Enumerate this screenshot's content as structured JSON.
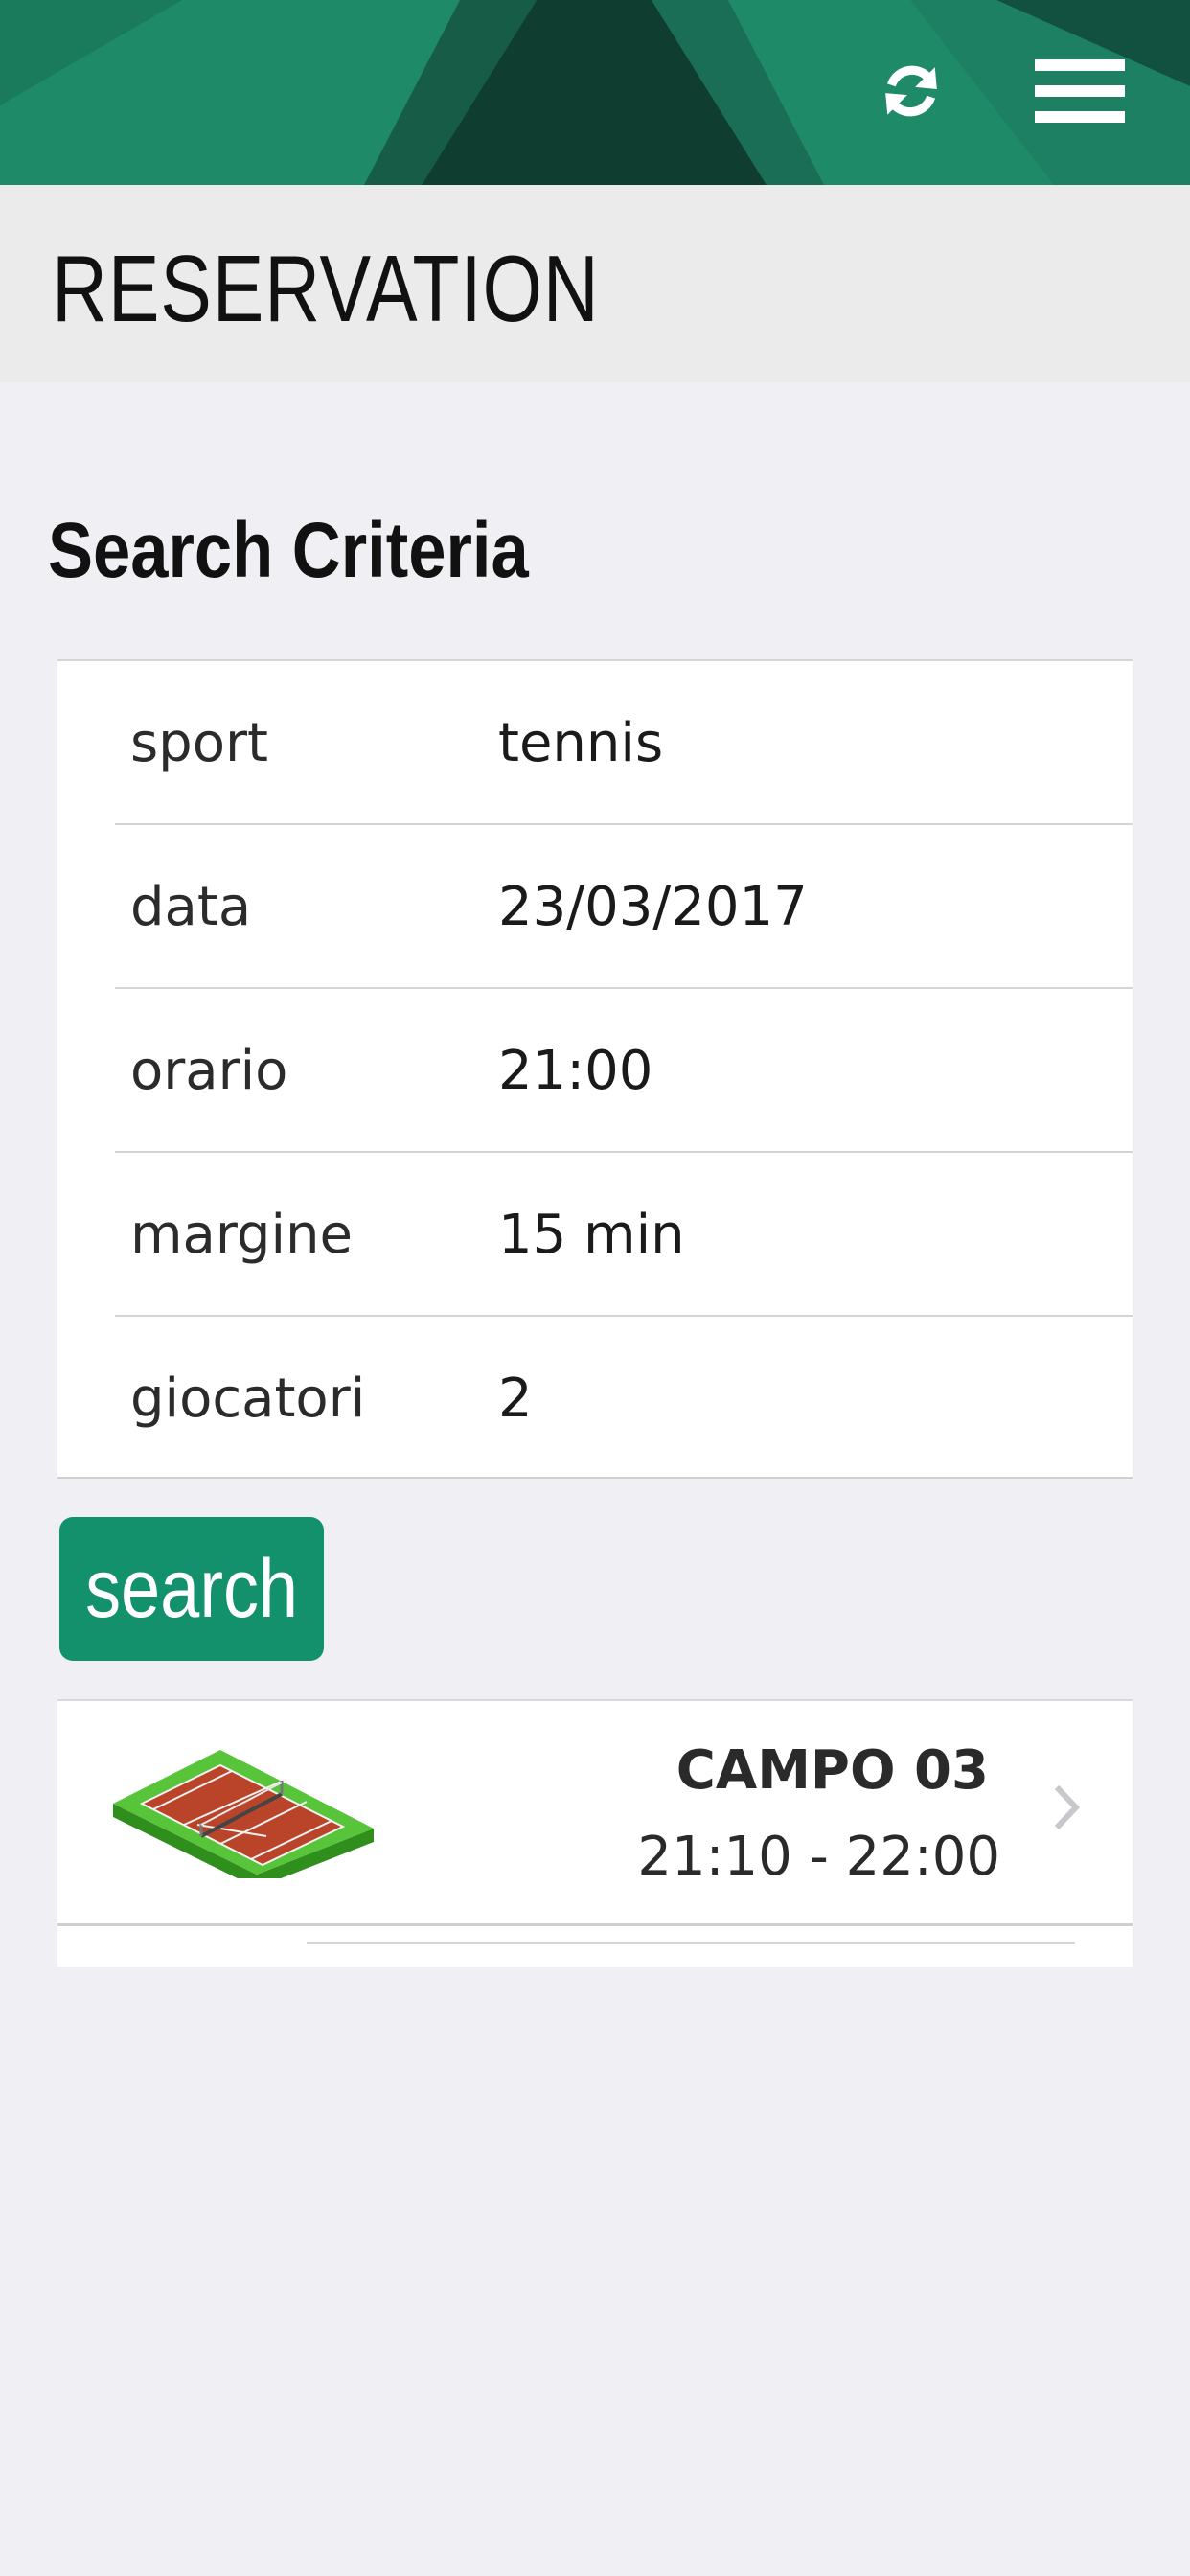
{
  "header": {
    "refresh_icon": "refresh-icon",
    "menu_icon": "hamburger-menu-icon",
    "brand_color": "#1f8a68"
  },
  "page": {
    "title": "RESERVATION"
  },
  "criteria": {
    "heading": "Search Criteria",
    "rows": [
      {
        "label": "sport",
        "value": "tennis"
      },
      {
        "label": "data",
        "value": "23/03/2017"
      },
      {
        "label": "orario",
        "value": "21:00"
      },
      {
        "label": "margine",
        "value": "15 min"
      },
      {
        "label": "giocatori",
        "value": "2"
      }
    ]
  },
  "search": {
    "label": "search",
    "color": "#13906c"
  },
  "results": [
    {
      "icon": "tennis-court-icon",
      "name": "CAMPO 03",
      "time": "21:10 - 22:00"
    }
  ]
}
